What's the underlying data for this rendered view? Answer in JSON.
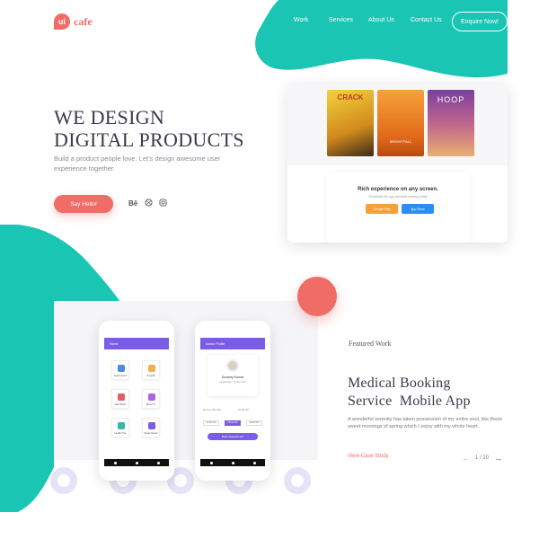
{
  "brand": {
    "mark": "ui",
    "name": "cafe",
    "accent": "#f06c66",
    "teal": "#1bc5b4"
  },
  "nav": {
    "items": [
      "Work",
      "Services",
      "About Us",
      "Contact Us"
    ],
    "cta": "Enquire Now!"
  },
  "hero": {
    "title_line1": "WE DESIGN",
    "title_line2": "DIGITAL PRODUCTS",
    "subtitle": "Build a product people love. Let's design awesome user experience together.",
    "cta": "Say Hello!",
    "social_icons": [
      "behance-icon",
      "dribbble-icon",
      "instagram-icon"
    ]
  },
  "showcase": {
    "books": [
      {
        "title": "CRACK",
        "color": "#e8c23a"
      },
      {
        "title": "BRIGHTFALL",
        "color": "#f08a24"
      },
      {
        "title": "HOOP",
        "color": "#8d4fa8"
      }
    ],
    "rich_title": "Rich experience on any screen.",
    "rich_sub": "Download the app and start reading today",
    "store_buttons": [
      "Google Play",
      "App Store"
    ]
  },
  "portfolio": {
    "label": "Featured Work",
    "title_line1": "Medical Booking",
    "title_line2": "Service  Mobile App",
    "description": "A wonderful serenity has taken possession of my entire soul, like these sweet mornings of spring which I enjoy with my whole heart.",
    "link": "View Case Study",
    "pager": "1 / 10",
    "phone1": {
      "header": "Home",
      "tiles": [
        {
          "label": "Appointment",
          "color": "#4a8de0"
        },
        {
          "label": "Hospital",
          "color": "#f2b24a"
        },
        {
          "label": "Bed Book",
          "color": "#e85a6a"
        },
        {
          "label": "Blood Tx",
          "color": "#b063e0"
        },
        {
          "label": "Health Tips",
          "color": "#3ab6a4"
        },
        {
          "label": "Speak Doctor",
          "color": "#7b5ce6"
        }
      ]
    },
    "phone2": {
      "header": "Doctor Profile",
      "doctor_name": "Suzanty Kumar",
      "doctor_role": "Cardiologist - Apollo Clinic",
      "field_left": "29 Aug, Monday",
      "field_right": "10:30 AM",
      "times": [
        "10:30 PM",
        "08:00 PM",
        "09:00 PM"
      ],
      "book_btn": "Book Appointment"
    }
  }
}
